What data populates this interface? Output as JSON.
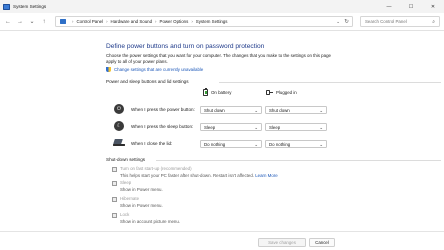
{
  "window": {
    "title": "System Settings",
    "controls": {
      "minimize": "—",
      "maximize": "☐",
      "close": "✕"
    }
  },
  "nav": {
    "back": "←",
    "forward": "→",
    "recent": "⌄",
    "up": "↑",
    "breadcrumb": [
      "Control Panel",
      "Hardware and Sound",
      "Power Options",
      "System Settings"
    ],
    "separator": "›",
    "dropdown": "⌄",
    "refresh": "↻",
    "search_placeholder": "Search Control Panel",
    "search_icon": "⌕"
  },
  "main": {
    "heading": "Define power buttons and turn on password protection",
    "description": "Choose the power settings that you want for your computer. The changes that you make to the settings on this page apply to all of your power plans.",
    "change_link": "Change settings that are currently unavailable",
    "section_buttons": "Power and sleep buttons and lid settings",
    "col_battery": "On battery",
    "col_plugged": "Plugged in",
    "rows": [
      {
        "label": "When I press the power button:",
        "icon": "power-icon",
        "battery": "Shut down",
        "plugged": "Shut down"
      },
      {
        "label": "When I press the sleep button:",
        "icon": "moon-icon",
        "battery": "Sleep",
        "plugged": "Sleep"
      },
      {
        "label": "When I close the lid:",
        "icon": "laptop-lid-icon",
        "battery": "Do nothing",
        "plugged": "Do nothing"
      }
    ],
    "dropdown_chevron": "⌄",
    "section_shutdown": "Shut-down settings",
    "shutdown": [
      {
        "title": "Turn on fast start-up (recommended)",
        "sub": "This helps start your PC faster after shut-down. Restart isn't affected.",
        "link": "Learn More"
      },
      {
        "title": "Sleep",
        "sub": "Show in Power menu."
      },
      {
        "title": "Hibernate",
        "sub": "Show in Power menu."
      },
      {
        "title": "Lock",
        "sub": "Show in account picture menu."
      }
    ]
  },
  "footer": {
    "save": "Save changes",
    "cancel": "Cancel"
  }
}
